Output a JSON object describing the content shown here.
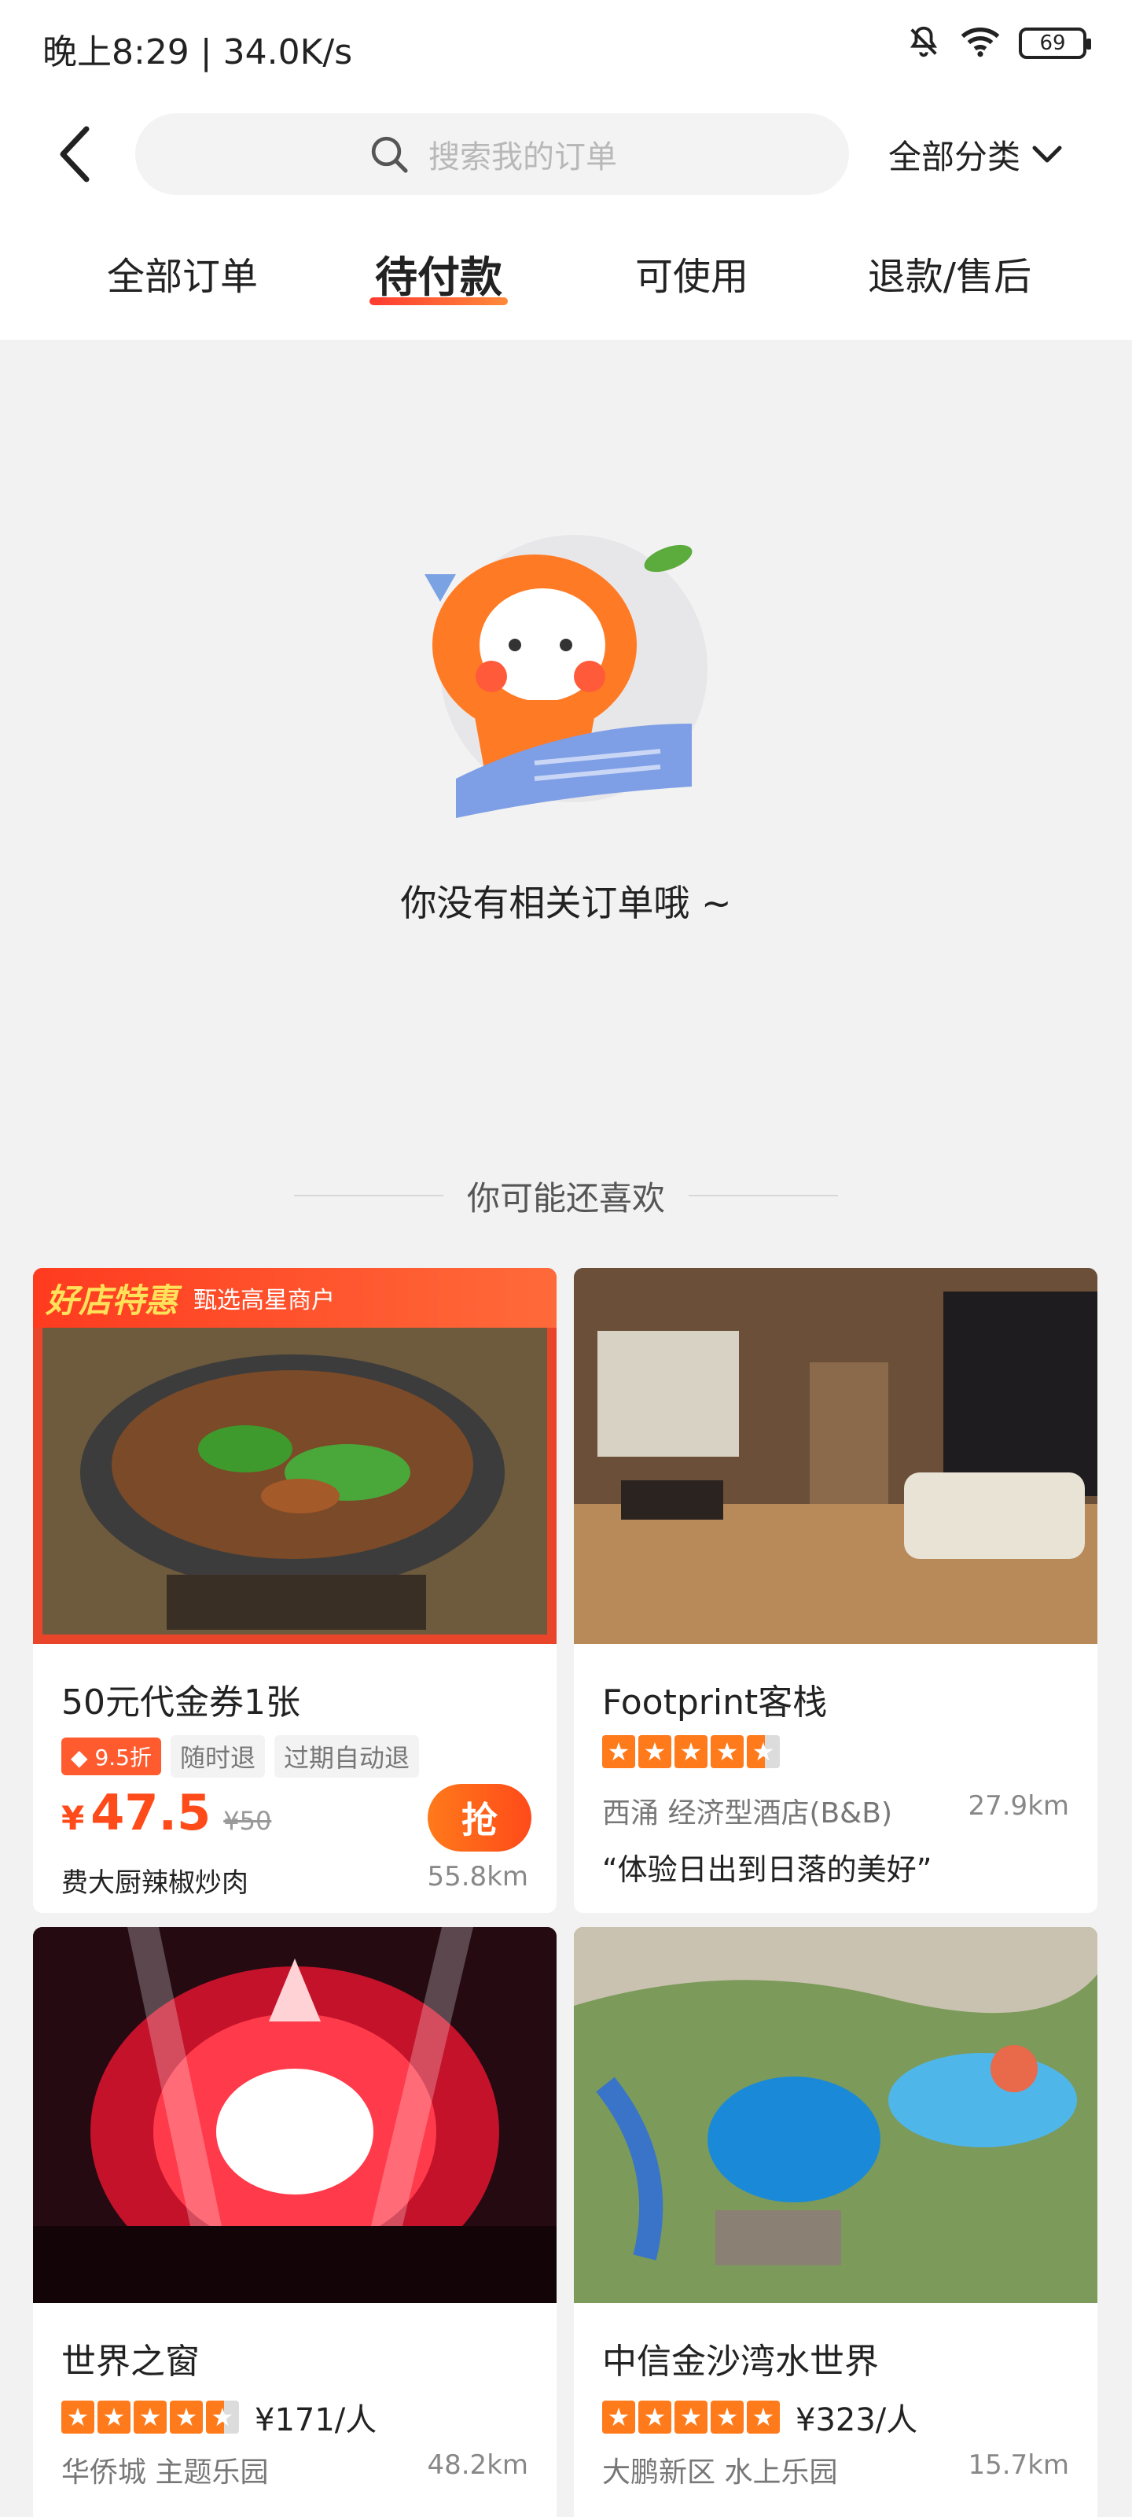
{
  "status_bar": {
    "left": "晚上8:29 | 34.0K/s",
    "battery": "69"
  },
  "header": {
    "search_placeholder": "搜索我的订单",
    "category_label": "全部分类"
  },
  "tabs": [
    {
      "label": "全部订单",
      "active": false
    },
    {
      "label": "待付款",
      "active": true
    },
    {
      "label": "可使用",
      "active": false
    },
    {
      "label": "退款/售后",
      "active": false
    }
  ],
  "empty_state": {
    "text": "你没有相关订单哦 ~"
  },
  "recommend": {
    "title": "你可能还喜欢",
    "cards": [
      {
        "banner_main": "好店特惠",
        "banner_sub": "甄选高星商户",
        "title": "50元代金券1张",
        "discount": "9.5折",
        "tags": [
          "随时退",
          "过期自动退"
        ],
        "price_symbol": "¥",
        "price": "47.5",
        "orig_price": "¥50",
        "button": "抢",
        "shop": "费大厨辣椒炒肉",
        "distance": "55.8km"
      },
      {
        "title": "Footprint客栈",
        "rating": 4.5,
        "meta": "西涌  经济型酒店(B&B)",
        "distance": "27.9km",
        "quote": "“体验日出到日落的美好”"
      },
      {
        "title": "世界之窗",
        "rating": 4.5,
        "per_price": "¥171/人",
        "meta": "华侨城  主题乐园",
        "distance": "48.2km"
      },
      {
        "title": "中信金沙湾水世界",
        "rating": 5,
        "per_price": "¥323/人",
        "meta": "大鹏新区  水上乐园",
        "distance": "15.7km"
      }
    ]
  },
  "colors": {
    "accent": "#ff4a1a",
    "tab_underline": "#ff3a30"
  }
}
